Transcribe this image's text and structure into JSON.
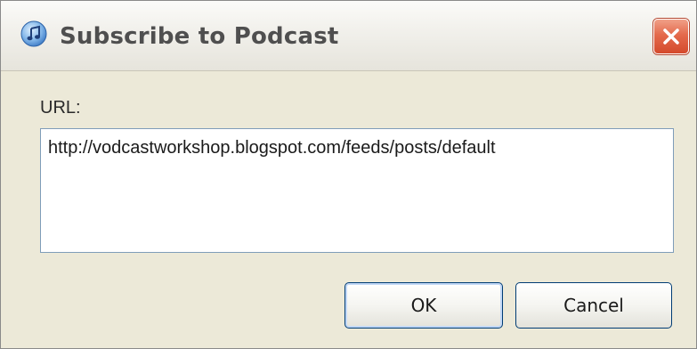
{
  "window": {
    "title": "Subscribe to Podcast",
    "app_icon": "itunes-music-note-icon",
    "close_icon": "close-icon"
  },
  "form": {
    "url_label": "URL:",
    "url_value": "http://vodcastworkshop.blogspot.com/feeds/posts/default"
  },
  "buttons": {
    "ok_label": "OK",
    "cancel_label": "Cancel"
  },
  "colors": {
    "close_button": "#e46a4c",
    "dialog_background": "#ece9d8",
    "input_border": "#7f9db9"
  }
}
